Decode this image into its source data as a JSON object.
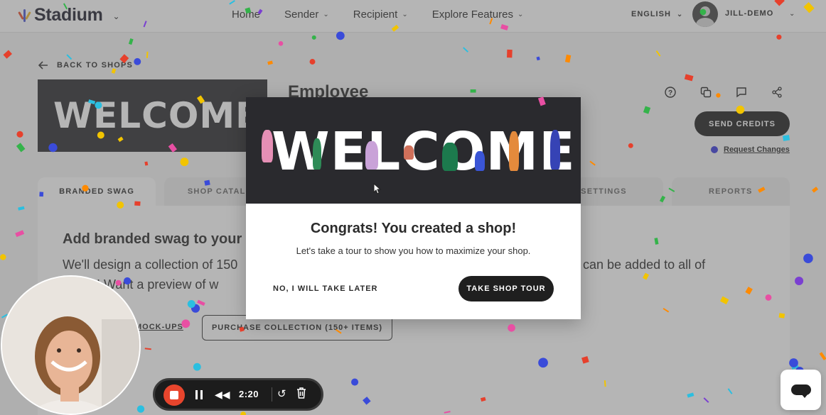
{
  "nav": {
    "brand": "Stadium",
    "links": [
      {
        "label": "Home",
        "has_caret": false
      },
      {
        "label": "Sender",
        "has_caret": true
      },
      {
        "label": "Recipient",
        "has_caret": true
      },
      {
        "label": "Explore Features",
        "has_caret": true
      }
    ],
    "language": "ENGLISH",
    "user": "JILL-DEMO"
  },
  "page": {
    "back_label": "BACK TO SHOPS",
    "banner_text": "WELCOME",
    "shop_title": "Employee",
    "send_credits": "SEND CREDITS",
    "request_changes": "Request Changes",
    "tabs": [
      "BRANDED SWAG",
      "SHOP CATALOG",
      "",
      "",
      "SETTINGS",
      "REPORTS"
    ],
    "heading": "Add branded swag to your",
    "text_line1": "We'll design a collection of 150",
    "text_line1_end": "can be added to all of",
    "text_line2": "shops! Want a preview of w",
    "mockups_link": "MOCK-UPS",
    "purchase_button": "PURCHASE COLLECTION (150+ ITEMS)"
  },
  "modal": {
    "banner_text": "WELCOME",
    "title": "Congrats! You created a shop!",
    "subtitle": "Let's take a tour to show you how to maximize your shop.",
    "secondary_action": "NO, I WILL TAKE LATER",
    "primary_action": "TAKE SHOP TOUR"
  },
  "recorder": {
    "time": "2:20"
  },
  "colors": {
    "stop": "#e8452d",
    "dark": "#1f1f1f",
    "banner_bg": "#2a2a2e"
  }
}
